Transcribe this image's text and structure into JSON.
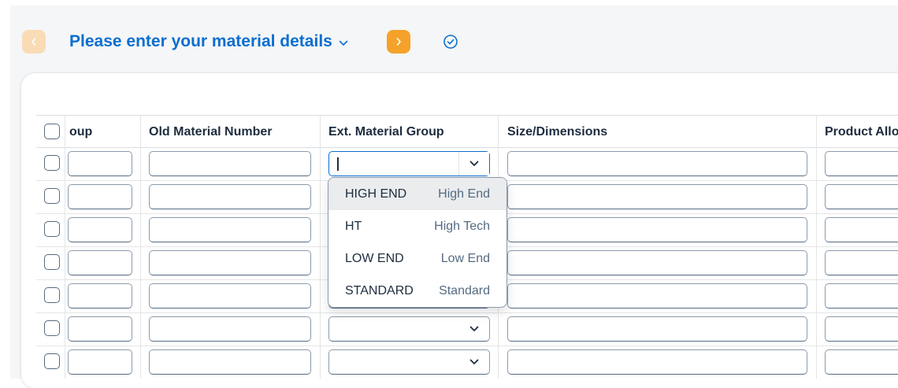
{
  "header": {
    "title": "Please enter your material details",
    "prev_label": "<",
    "next_label": ">"
  },
  "table": {
    "columns": [
      "oup",
      "Old Material Number",
      "Ext. Material Group",
      "Size/Dimensions",
      "Product Allo"
    ],
    "row_count": 7
  },
  "dropdown": {
    "options": [
      {
        "key": "HIGH END",
        "text": "High End",
        "highlighted": true
      },
      {
        "key": "HT",
        "text": "High Tech",
        "highlighted": false
      },
      {
        "key": "LOW END",
        "text": "Low End",
        "highlighted": false
      },
      {
        "key": "STANDARD",
        "text": "Standard",
        "highlighted": false
      }
    ]
  },
  "colors": {
    "accent": "#0a6ed1",
    "nav_active": "#f5a22b",
    "nav_disabled": "#f9dcb5",
    "text": "#1d2d3e"
  }
}
